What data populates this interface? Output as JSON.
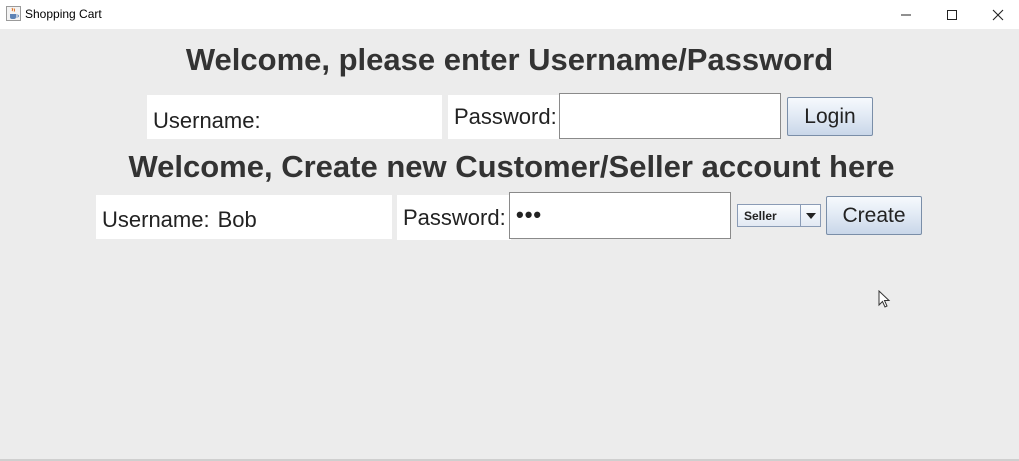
{
  "window": {
    "title": "Shopping Cart",
    "icon": "java-cup-icon"
  },
  "login": {
    "heading": "Welcome, please enter Username/Password",
    "username_label": "Username:",
    "username_value": "",
    "password_label": "Password:",
    "password_value": "",
    "login_button": "Login"
  },
  "create": {
    "heading": "Welcome, Create new Customer/Seller account here",
    "username_label": "Username:",
    "username_value": "Bob",
    "password_label": "Password:",
    "password_masked": "•••",
    "account_type_selected": "Seller",
    "create_button": "Create"
  }
}
